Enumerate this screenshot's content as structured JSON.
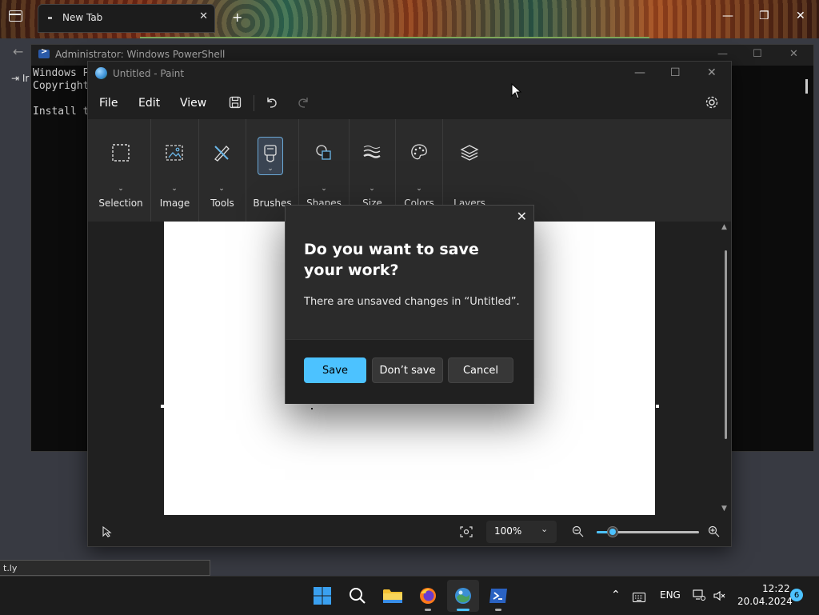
{
  "browser": {
    "tab_label": "New Tab",
    "tab_close": "✕",
    "minimize": "—",
    "restore": "❐",
    "close": "✕",
    "back": "←",
    "login_partial": "⇥ Ir",
    "status_url": "t.ly"
  },
  "powershell": {
    "title": "Administrator: Windows PowerShell",
    "line1": "Windows P",
    "line2": "Copyright",
    "line3": "Install t",
    "minimize": "—",
    "maximize": "☐",
    "close": "✕"
  },
  "paint": {
    "title": "Untitled - Paint",
    "minimize": "—",
    "maximize": "☐",
    "close": "✕",
    "menu": {
      "file": "File",
      "edit": "Edit",
      "view": "View"
    },
    "ribbon": {
      "selection": "Selection",
      "image": "Image",
      "tools": "Tools",
      "brushes": "Brushes",
      "shapes": "Shapes",
      "size": "Size",
      "colors": "Colors",
      "layers": "Layers"
    },
    "zoom": "100%"
  },
  "dialog": {
    "title": "Do you want to save your work?",
    "message": "There are unsaved changes in “Untitled”.",
    "save": "Save",
    "dont_save": "Don’t save",
    "cancel": "Cancel",
    "close": "✕"
  },
  "taskbar": {
    "language": "ENG",
    "time": "12:22",
    "date": "20.04.2024",
    "notifications": "6"
  },
  "colors": {
    "accent": "#4cc2ff",
    "paint_bg": "#202020",
    "ribbon_bg": "#2b2b2b"
  }
}
